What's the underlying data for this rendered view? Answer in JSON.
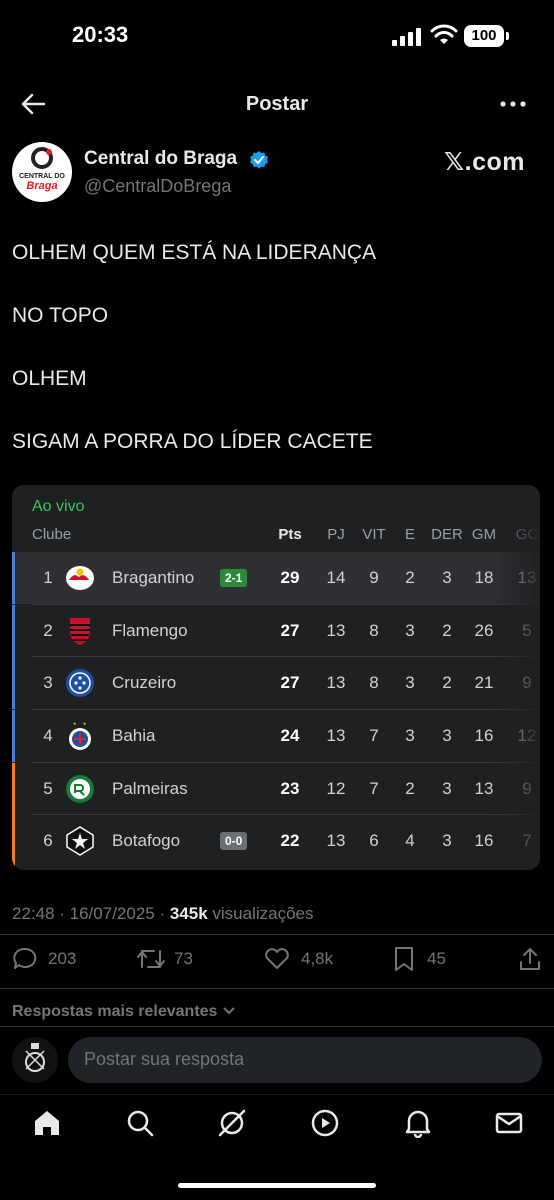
{
  "status_bar": {
    "time": "20:33",
    "battery": "100"
  },
  "header": {
    "title": "Postar"
  },
  "author": {
    "name": "Central do Braga",
    "handle": "@CentralDoBrega",
    "avatar_top": "CENTRAL DO",
    "avatar_bottom": "Braga"
  },
  "watermark": "𝕏.com",
  "tweet_lines": [
    "OLHEM QUEM ESTÁ NA LIDERANÇA",
    "NO TOPO",
    "OLHEM",
    "SIGAM A PORRA DO LÍDER CACETE"
  ],
  "table": {
    "live_label": "Ao vivo",
    "headers": {
      "club": "Clube",
      "pts": "Pts",
      "pj": "PJ",
      "vit": "VIT",
      "e": "E",
      "der": "DER",
      "gm": "GM",
      "gc": "GC"
    },
    "rows": [
      {
        "pos": "1",
        "club": "Bragantino",
        "badge": "2-1",
        "pts": "29",
        "pj": "14",
        "vit": "9",
        "e": "2",
        "der": "3",
        "gm": "18",
        "gc": "13"
      },
      {
        "pos": "2",
        "club": "Flamengo",
        "badge": "",
        "pts": "27",
        "pj": "13",
        "vit": "8",
        "e": "3",
        "der": "2",
        "gm": "26",
        "gc": "5"
      },
      {
        "pos": "3",
        "club": "Cruzeiro",
        "badge": "",
        "pts": "27",
        "pj": "13",
        "vit": "8",
        "e": "3",
        "der": "2",
        "gm": "21",
        "gc": "9"
      },
      {
        "pos": "4",
        "club": "Bahia",
        "badge": "",
        "pts": "24",
        "pj": "13",
        "vit": "7",
        "e": "3",
        "der": "3",
        "gm": "16",
        "gc": "12"
      },
      {
        "pos": "5",
        "club": "Palmeiras",
        "badge": "",
        "pts": "23",
        "pj": "12",
        "vit": "7",
        "e": "2",
        "der": "3",
        "gm": "13",
        "gc": "9"
      },
      {
        "pos": "6",
        "club": "Botafogo",
        "badge": "0-0",
        "pts": "22",
        "pj": "13",
        "vit": "6",
        "e": "4",
        "der": "3",
        "gm": "16",
        "gc": "7"
      }
    ]
  },
  "meta": {
    "time_date": "22:48 · 16/07/2025 · ",
    "views_count": "345k",
    "views_label": " visualizações"
  },
  "actions": {
    "replies": "203",
    "reposts": "73",
    "likes": "4,8k",
    "bookmarks": "45"
  },
  "replies": {
    "heading": "Respostas mais relevantes",
    "placeholder": "Postar sua resposta"
  },
  "colors": {
    "live_green": "#3ec45a",
    "libertadores_blue": "#4a7fd4",
    "pre_libertadores_orange": "#f07e22",
    "verified_blue": "#1d9bf0",
    "win_badge": "#2c8a3c",
    "draw_badge": "#6b6f74"
  }
}
